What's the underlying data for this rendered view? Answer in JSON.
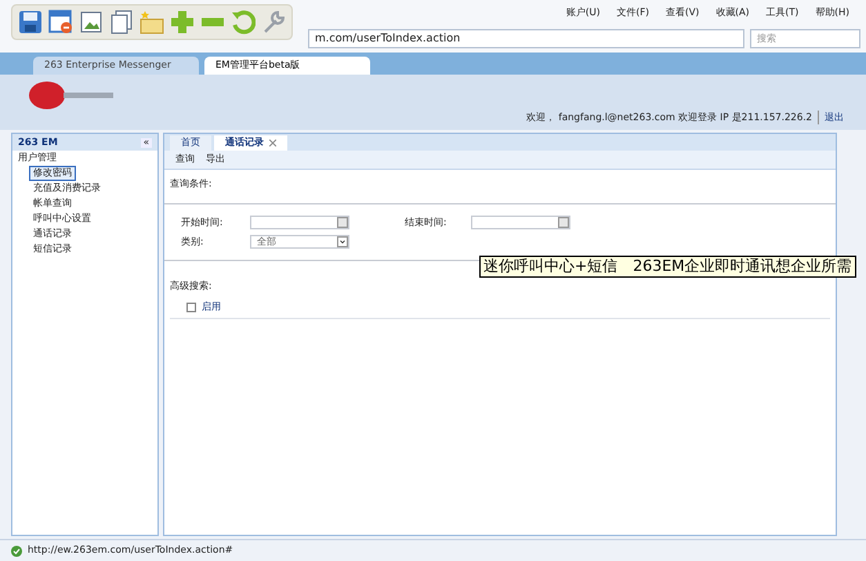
{
  "menu_bar": [
    "账户(U)",
    "文件(F)",
    "查看(V)",
    "收藏(A)",
    "工具(T)",
    "帮助(H)"
  ],
  "address_bar": {
    "value": "m.com/userToIndex.action",
    "search_placeholder": "搜索"
  },
  "browser_tabs": [
    {
      "label": "263 Enterprise Messenger",
      "selected": false
    },
    {
      "label": "EM管理平台beta版",
      "selected": true
    }
  ],
  "header": {
    "welcome": "欢迎， fangfang.l@net263.com 欢迎登录 IP 是211.157.226.2",
    "logout": "退出"
  },
  "sidebar": {
    "title": "263 EM",
    "collapse": "«",
    "section": "用户管理",
    "items": [
      {
        "label": "修改密码",
        "selected": true
      },
      {
        "label": "充值及消费记录",
        "selected": false
      },
      {
        "label": "帐单查询",
        "selected": false
      },
      {
        "label": "呼叫中心设置",
        "selected": false
      },
      {
        "label": "通话记录",
        "selected": false
      },
      {
        "label": "短信记录",
        "selected": false
      }
    ]
  },
  "content_tabs": [
    {
      "label": "首页",
      "selected": false,
      "closable": false
    },
    {
      "label": "通话记录",
      "selected": true,
      "closable": true
    }
  ],
  "actions": [
    "查询",
    "导出"
  ],
  "query": {
    "title": "查询条件:",
    "start_label": "开始时间:",
    "end_label": "结束时间:",
    "type_label": "类别:",
    "type_value": "全部"
  },
  "advanced": {
    "title": "高级搜索:",
    "enable_label": "启用",
    "checked": false
  },
  "tooltip": "迷你呼叫中心+短信　263EM企业即时通讯想企业所需",
  "status_bar": {
    "url": "http://ew.263em.com/userToIndex.action#"
  }
}
